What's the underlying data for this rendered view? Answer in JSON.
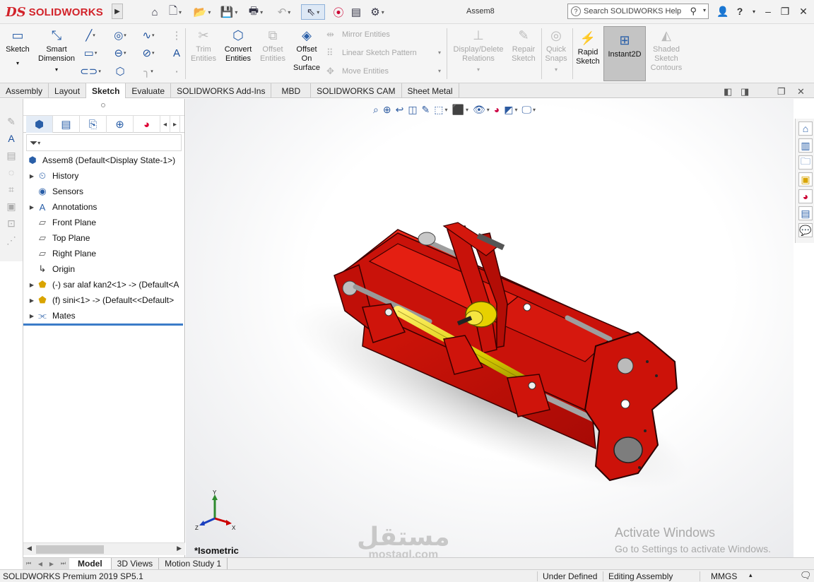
{
  "app": {
    "brand_ds": "DS",
    "brand": "SOLIDWORKS",
    "document_title": "Assem8",
    "search_placeholder": "Search SOLIDWORKS Help",
    "accent_color": "#d2232a"
  },
  "ribbon": {
    "sketch": "Sketch",
    "smart_dimension_1": "Smart",
    "smart_dimension_2": "Dimension",
    "trim_1": "Trim",
    "trim_2": "Entities",
    "convert_1": "Convert",
    "convert_2": "Entities",
    "offset_1": "Offset",
    "offset_2": "Entities",
    "offset_surface_1": "Offset",
    "offset_surface_2": "On",
    "offset_surface_3": "Surface",
    "mirror": "Mirror Entities",
    "linear_pattern": "Linear Sketch Pattern",
    "move": "Move Entities",
    "display_delete_1": "Display/Delete",
    "display_delete_2": "Relations",
    "repair_1": "Repair",
    "repair_2": "Sketch",
    "quick_snaps_1": "Quick",
    "quick_snaps_2": "Snaps",
    "rapid_1": "Rapid",
    "rapid_2": "Sketch",
    "instant2d": "Instant2D",
    "shaded_1": "Shaded",
    "shaded_2": "Sketch",
    "shaded_3": "Contours"
  },
  "tabs": [
    "Assembly",
    "Layout",
    "Sketch",
    "Evaluate",
    "SOLIDWORKS Add-Ins",
    "MBD",
    "SOLIDWORKS CAM",
    "Sheet Metal"
  ],
  "active_tab": "Sketch",
  "tree": {
    "root": "Assem8  (Default<Display State-1>)",
    "items": [
      {
        "label": "History",
        "icon": "history-icon"
      },
      {
        "label": "Sensors",
        "icon": "sensors-icon"
      },
      {
        "label": "Annotations",
        "icon": "annotations-icon"
      },
      {
        "label": "Front Plane",
        "icon": "plane-icon"
      },
      {
        "label": "Top Plane",
        "icon": "plane-icon"
      },
      {
        "label": "Right Plane",
        "icon": "plane-icon"
      },
      {
        "label": "Origin",
        "icon": "origin-icon"
      },
      {
        "label": "(-) sar alaf kan2<1> -> (Default<A",
        "icon": "part-icon"
      },
      {
        "label": "(f) sini<1> -> (Default<<Default>",
        "icon": "part-icon"
      },
      {
        "label": "Mates",
        "icon": "mates-icon"
      }
    ]
  },
  "viewport": {
    "view_name": "*Isometric",
    "triad_x": "X",
    "triad_y": "Y",
    "triad_z": "Z",
    "model_color": "#d01010"
  },
  "activation": {
    "line1": "Activate Windows",
    "line2": "Go to Settings to activate Windows."
  },
  "watermark": {
    "arabic": "مستقل",
    "latin": "mostaql.com"
  },
  "bottom_tabs": [
    "Model",
    "3D Views",
    "Motion Study 1"
  ],
  "active_bottom_tab": "Model",
  "status": {
    "product": "SOLIDWORKS Premium 2019 SP5.1",
    "sketch_state": "Under Defined",
    "mode": "Editing Assembly",
    "units": "MMGS"
  }
}
